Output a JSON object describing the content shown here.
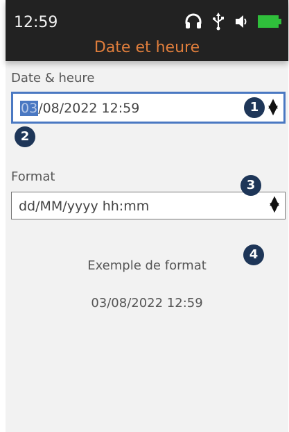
{
  "status_bar": {
    "time": "12:59",
    "icons": [
      "headphones-icon",
      "usb-icon",
      "speaker-icon",
      "battery-icon"
    ]
  },
  "title": "Date et heure",
  "date_time": {
    "label": "Date & heure",
    "value_highlighted": "03",
    "value_rest": "/08/2022 12:59"
  },
  "format": {
    "label": "Format",
    "selected": "dd/MM/yyyy hh:mm"
  },
  "example": {
    "title": "Exemple de format",
    "value": "03/08/2022 12:59"
  },
  "callouts": [
    "1",
    "2",
    "3",
    "4"
  ],
  "colors": {
    "title": "#e07e3c",
    "focus_border": "#4a78c2",
    "callout_bg": "#1e3658",
    "battery": "#2fbf3b"
  }
}
